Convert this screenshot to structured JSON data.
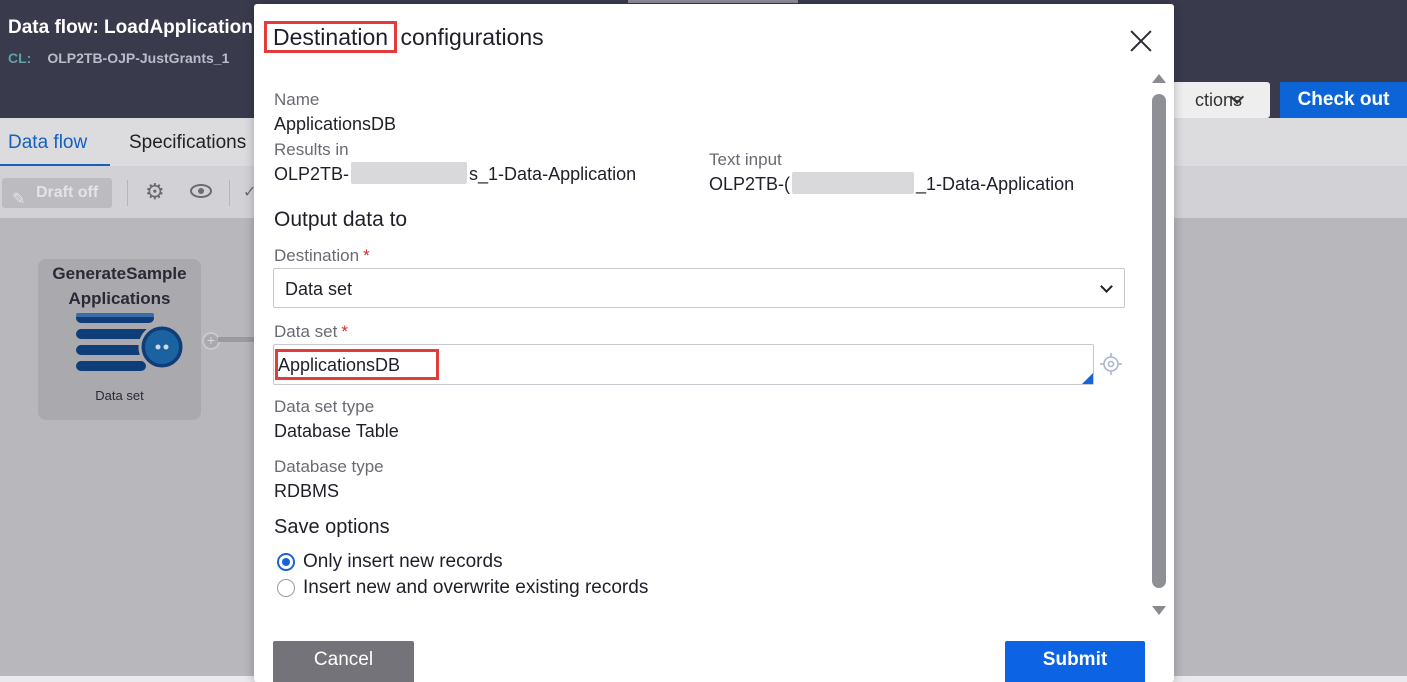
{
  "background": {
    "title": "Data flow: LoadApplication",
    "cl_label": "CL:",
    "cl_value": "OLP2TB-OJP-JustGrants_1",
    "actions_label": "ctions",
    "checkout_label": "Check out",
    "tabs": [
      {
        "label": "Data flow",
        "active": true
      },
      {
        "label": "Specifications",
        "active": false
      }
    ],
    "draft_label": "Draft off",
    "node": {
      "title_line1": "GenerateSample",
      "title_line2": "Applications",
      "label": "Data set"
    },
    "accent_color": "#1560bd"
  },
  "modal": {
    "title_highlight": "Destination",
    "title_rest": " configurations",
    "name_label": "Name",
    "name_value": "ApplicationsDB",
    "results_label": "Results in",
    "results_prefix": "OLP2TB-",
    "results_suffix": "s_1-Data-Application",
    "text_input_label": "Text input",
    "text_input_prefix": "OLP2TB-(",
    "text_input_suffix": "_1-Data-Application",
    "output_title": "Output data to",
    "destination_label": "Destination",
    "destination_value": "Data set",
    "dataset_label": "Data set",
    "dataset_value": "ApplicationsDB",
    "dataset_type_label": "Data set type",
    "dataset_type_value": "Database Table",
    "database_type_label": "Database type",
    "database_type_value": "RDBMS",
    "save_options_title": "Save options",
    "save_options": [
      {
        "label": "Only insert new records",
        "checked": true
      },
      {
        "label": "Insert new and overwrite existing records",
        "checked": false
      }
    ],
    "cancel_label": "Cancel",
    "submit_label": "Submit",
    "required_mark": "*",
    "primary_color": "#0c64e4",
    "highlight_color": "#e33b3b"
  }
}
